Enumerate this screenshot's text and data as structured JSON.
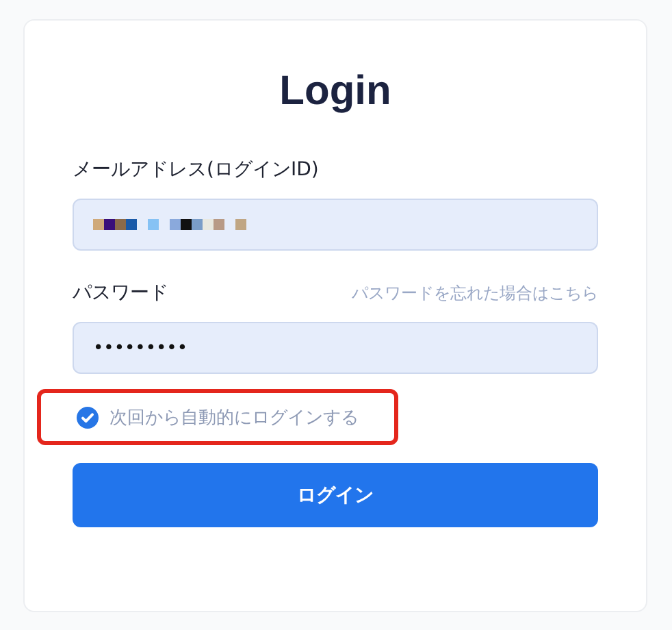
{
  "title": "Login",
  "email": {
    "label": "メールアドレス(ログインID)"
  },
  "password": {
    "label": "パスワード",
    "forgot_link": "パスワードを忘れた場合はこちら",
    "value": "•••••••••"
  },
  "remember": {
    "label": "次回から自動的にログインする",
    "checked": true
  },
  "submit": "ログイン"
}
